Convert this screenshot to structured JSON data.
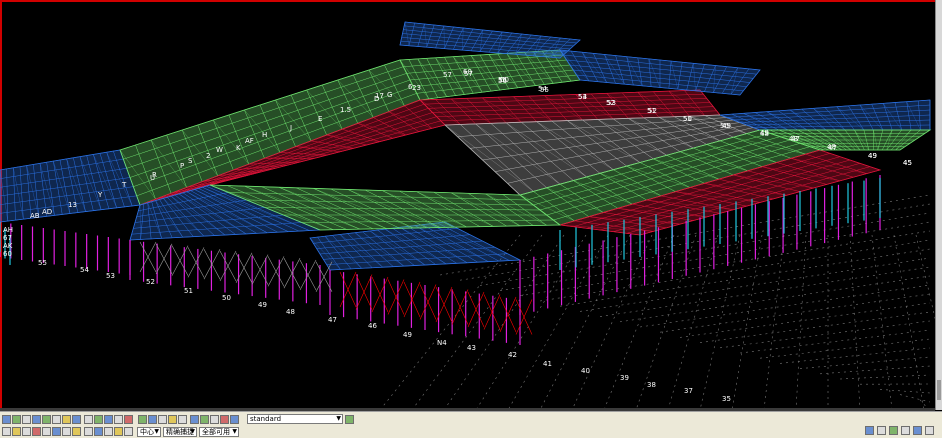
{
  "viewport": {
    "grid_labels": [
      "55",
      "54",
      "53",
      "52",
      "51",
      "50",
      "49",
      "48",
      "47",
      "46",
      "45",
      "44",
      "43",
      "42",
      "41",
      "40",
      "39",
      "38",
      "37",
      "36",
      "35",
      "60",
      "59",
      "58",
      "57",
      "56",
      "S",
      "F",
      "E",
      "D",
      "G",
      "H",
      "J",
      "K",
      "L",
      "M",
      "N",
      "P",
      "Q",
      "R",
      "T",
      "U",
      "V",
      "W",
      "X",
      "Y",
      "Z",
      "AA",
      "AB",
      "AC",
      "AD",
      "AE",
      "AF",
      "AG",
      "AH",
      "AJ",
      "AK",
      "AL"
    ],
    "left_labels": [
      "AH",
      "67",
      "AK",
      "60"
    ],
    "near_labels": [
      "55",
      "54",
      "53",
      "52",
      "51",
      "50",
      "49",
      "48",
      "47",
      "46",
      "49",
      "N4",
      "43",
      "42",
      "41",
      "40",
      "39",
      "38",
      "37",
      "35"
    ],
    "right_labels": [
      "49",
      "45",
      "47",
      "48",
      "49",
      "50",
      "51",
      "52",
      "53",
      "54",
      "55",
      "56",
      "57",
      "60"
    ],
    "roof_labels": [
      "AB",
      "AD",
      "13",
      "Y",
      "T",
      "R",
      "P",
      "2",
      "K",
      "H",
      "J",
      "E",
      "D",
      "G",
      "6",
      "57",
      "60",
      "55",
      "54",
      "53",
      "52",
      "51",
      "50",
      "49",
      "48",
      "47",
      "48",
      "49",
      "45",
      "1.5",
      "17",
      "23",
      "U",
      "S",
      "W",
      "AF"
    ]
  },
  "toolbar": {
    "view_select": "standard",
    "second_row_items": [
      "中心",
      "精确捕捉",
      "全部可用"
    ],
    "right_icons": [
      "zoom-icon",
      "pan-icon",
      "rotate-icon",
      "fit-icon",
      "pick-icon"
    ]
  },
  "colors": {
    "background": "#000000",
    "roof_green": "#6de06d",
    "roof_red": "#e0143a",
    "roof_blue": "#2a6fe0",
    "column_magenta": "#e020e0",
    "column_cyan": "#20c8e0",
    "truss_gray": "#9a9a9a",
    "frame_red": "#ff0000"
  }
}
